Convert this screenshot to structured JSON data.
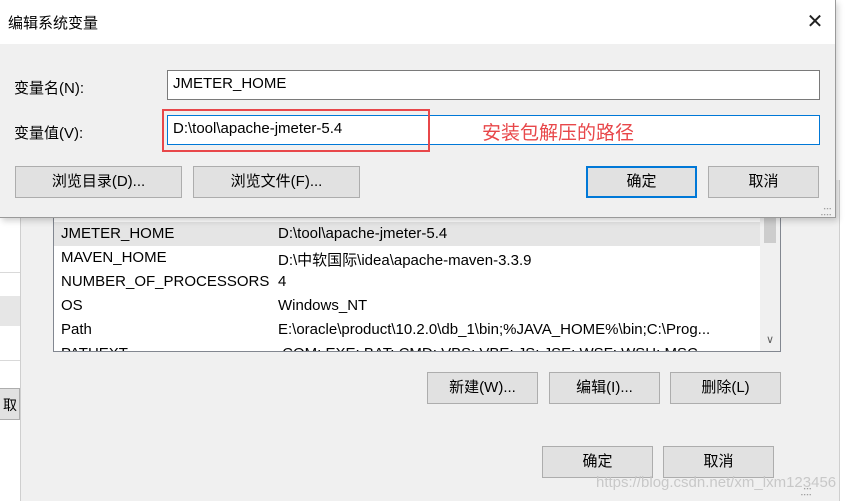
{
  "dialog": {
    "title": "编辑系统变量",
    "close_glyph": "✕",
    "name_label": "变量名(N):",
    "name_value": "JMETER_HOME",
    "value_label": "变量值(V):",
    "value_value": "D:\\tool\\apache-jmeter-5.4",
    "annotation": "安装包解压的路径",
    "annotation_color": "#e8474a",
    "browse_dir_label": "浏览目录(D)...",
    "browse_file_label": "浏览文件(F)...",
    "ok_label": "确定",
    "cancel_label": "取消"
  },
  "parent": {
    "variables": [
      {
        "name": "JMETER_HOME",
        "value": "D:\\tool\\apache-jmeter-5.4",
        "selected": true
      },
      {
        "name": "MAVEN_HOME",
        "value": "D:\\中软国际\\idea\\apache-maven-3.3.9"
      },
      {
        "name": "NUMBER_OF_PROCESSORS",
        "value": "4"
      },
      {
        "name": "OS",
        "value": "Windows_NT"
      },
      {
        "name": "Path",
        "value": "E:\\oracle\\product\\10.2.0\\db_1\\bin;%JAVA_HOME%\\bin;C:\\Prog..."
      },
      {
        "name": "PATHEXT",
        "value": ".COM;.EXE;.BAT;.CMD;.VBS;.VBE;.JS;.JSE;.WSF;.WSH;.MSC"
      }
    ],
    "new_label": "新建(W)...",
    "edit_label": "编辑(I)...",
    "delete_label": "删除(L)",
    "ok_label": "确定",
    "cancel_label": "取消",
    "peek_label": "取"
  },
  "watermark": "https://blog.csdn.net/xm_lxm123456",
  "icons": {
    "scroll_down": "chevron-down-icon",
    "close": "close-icon"
  }
}
